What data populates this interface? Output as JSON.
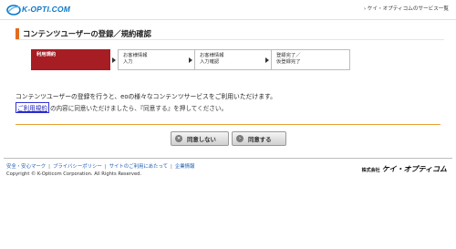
{
  "header": {
    "logo_text": "K-OPTI.COM",
    "nav_text": "› ケイ・オプティコムのサービス一覧"
  },
  "page": {
    "title": "コンテンツユーザーの登録／規約確認"
  },
  "steps": [
    {
      "label": "利用規約",
      "active": true
    },
    {
      "label": "お客様情報\n入力",
      "active": false
    },
    {
      "label": "お客様情報\n入力確認",
      "active": false
    },
    {
      "label": "登録完了／\n仮登録完了",
      "active": false
    }
  ],
  "body": {
    "intro": "コンテンツユーザーの登録を行うと、eoの様々なコンテンツサービスをご利用いただけます。",
    "terms_link": "ご利用規約",
    "terms_rest": "の内容に同意いただけましたら、『同意する』を押してください。"
  },
  "buttons": {
    "disagree": "同意しない",
    "agree": "同意する"
  },
  "footer": {
    "links": [
      "安全・安心マーク",
      "プライバシーポリシー",
      "サイトのご利用にあたって",
      "企業情報"
    ],
    "copyright": "Copyright © K-Opticom Corporation. All Rights Reserved.",
    "brand_prefix": "株式会社",
    "brand_name": "ケイ・オプティコム"
  },
  "colors": {
    "accent": "#e36b1e",
    "active_step": "#a61d24",
    "link": "#1a5cae",
    "logo": "#0b77c8"
  }
}
